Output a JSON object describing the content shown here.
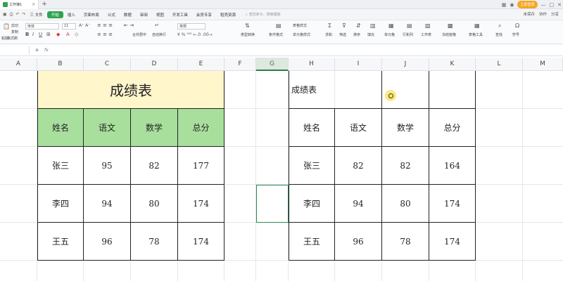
{
  "window": {
    "tab_title": "工作簿1",
    "new_tab": "+",
    "login_label": "立即登录",
    "min": "—",
    "max": "□",
    "close": "✕"
  },
  "menu": {
    "items": [
      "三 文件",
      "开始",
      "插入",
      "页面布局",
      "公式",
      "数据",
      "审阅",
      "视图",
      "开发工具",
      "会员专享",
      "稻壳资源"
    ],
    "active_index": 1,
    "search_placeholder": "查找命令、搜索模板",
    "right_items": [
      "未保存",
      "协作",
      "分享"
    ]
  },
  "toolbar": {
    "paste": "粘贴",
    "cut": "剪切",
    "copy": "复制",
    "format_painter": "格式刷",
    "font_name": "宋体",
    "font_size": "11",
    "merge_center": "合并居中",
    "wrap_text": "自动换行",
    "number_format": "常规",
    "type_convert": "类型转换",
    "cond_format": "条件格式",
    "table_style": "表格样式",
    "cell_style": "单元格样式",
    "sum": "求和",
    "filter": "筛选",
    "sort": "排序",
    "fill": "填充",
    "cell": "单元格",
    "row_col": "行和列",
    "worksheet": "工作表",
    "freeze": "冻结窗格",
    "table_tools": "表格工具",
    "find": "查找",
    "symbol": "符号"
  },
  "formula_bar": {
    "name_box": "G6",
    "fx": "fx",
    "zoom_icon": "⊕"
  },
  "columns": [
    "A",
    "B",
    "C",
    "D",
    "E",
    "F",
    "G",
    "H",
    "I",
    "J",
    "K",
    "L",
    "M"
  ],
  "selected_column": "G",
  "table1": {
    "title": "成绩表",
    "headers": [
      "姓名",
      "语文",
      "数学",
      "总分"
    ],
    "rows": [
      [
        "张三",
        "95",
        "82",
        "177"
      ],
      [
        "李四",
        "94",
        "80",
        "174"
      ],
      [
        "王五",
        "96",
        "78",
        "174"
      ]
    ],
    "title_bg": "#fff6cc",
    "header_bg": "#a8df9d"
  },
  "table2": {
    "title": "成绩表",
    "headers": [
      "姓名",
      "语文",
      "数学",
      "总分"
    ],
    "rows": [
      [
        "张三",
        "82",
        "82",
        "164"
      ],
      [
        "李四",
        "94",
        "80",
        "174"
      ],
      [
        "王五",
        "96",
        "78",
        "174"
      ]
    ]
  },
  "accent_color": "#2ea44f"
}
